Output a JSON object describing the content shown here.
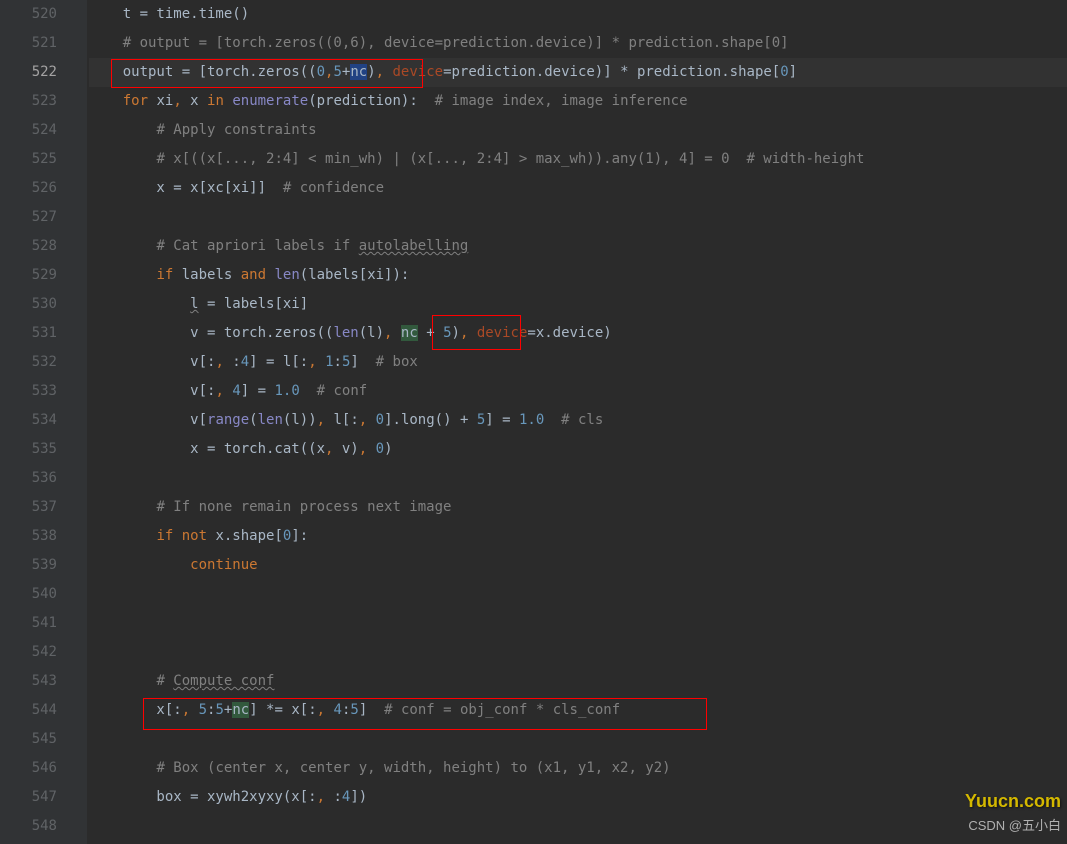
{
  "gutter": {
    "start": 520,
    "end": 548,
    "current": 522
  },
  "code": {
    "l520": {
      "pre": "    t = time.time()"
    },
    "l521": {
      "pre": "    ",
      "cmt": "# output = [torch.zeros((0,6), device=prediction.device)] * prediction.shape[0]"
    },
    "l522": {
      "a": "    output = [torch.zeros((",
      "n0": "0",
      "c": ",",
      "n5": "5",
      "plus": "+",
      "nc": "nc",
      "b": ")",
      "com": ",",
      "sp": " ",
      "dev": "device",
      "eq": "=prediction.device)] * prediction.shape[",
      "z": "0",
      "end": "]"
    },
    "l523": {
      "a": "    ",
      "for": "for",
      "b": " xi",
      "com": ",",
      "c": " x ",
      "in": "in",
      "d": " ",
      "enum": "enumerate",
      "e": "(prediction):  ",
      "cmt": "# image index, image inference"
    },
    "l524": {
      "pre": "        ",
      "cmt": "# Apply constraints"
    },
    "l525": {
      "pre": "        ",
      "cmt": "# x[((x[..., 2:4] < min_wh) | (x[..., 2:4] > max_wh)).any(1), 4] = 0  # width-height"
    },
    "l526": {
      "a": "        x = x[xc[xi]]  ",
      "cmt": "# confidence"
    },
    "l528": {
      "pre": "        ",
      "cmt1": "# Cat apriori labels if ",
      "auto": "autolabelling"
    },
    "l529": {
      "a": "        ",
      "if": "if",
      "b": " labels ",
      "and": "and",
      "c": " ",
      "len": "len",
      "d": "(labels[xi]):"
    },
    "l530": {
      "a": "            ",
      "l": "l",
      "b": " = labels[xi]"
    },
    "l531": {
      "a": "            v = torch.zeros((",
      "len": "len",
      "b": "(l)",
      "com": ",",
      "sp": " ",
      "nc": "nc",
      "c": " + ",
      "n5": "5",
      "d": ")",
      "com2": ",",
      "sp2": " ",
      "dev": "device",
      "e": "=x.device)"
    },
    "l532": {
      "a": "            v[:",
      "com": ",",
      "b": " :",
      "n4": "4",
      "c": "] = l[:",
      "com2": ",",
      "d": " ",
      "n1": "1",
      "e": ":",
      "n5": "5",
      "f": "]  ",
      "cmt": "# box"
    },
    "l533": {
      "a": "            v[:",
      "com": ",",
      "b": " ",
      "n4": "4",
      "c": "] = ",
      "f1": "1.0",
      "d": "  ",
      "cmt": "# conf"
    },
    "l534": {
      "a": "            v[",
      "range": "range",
      "b": "(",
      "len": "len",
      "c": "(l))",
      "com": ",",
      "d": " l[:",
      "com2": ",",
      "e": " ",
      "n0": "0",
      "f": "].long() + ",
      "n5": "5",
      "g": "] = ",
      "f1": "1.0",
      "h": "  ",
      "cmt": "# cls"
    },
    "l535": {
      "a": "            x = torch.cat((x",
      "com": ",",
      "b": " v)",
      "com2": ",",
      "c": " ",
      "n0": "0",
      "d": ")"
    },
    "l537": {
      "pre": "        ",
      "cmt": "# If none remain process next image"
    },
    "l538": {
      "a": "        ",
      "if": "if not",
      "b": " x.shape[",
      "n0": "0",
      "c": "]:"
    },
    "l539": {
      "a": "            ",
      "cont": "continue"
    },
    "l543": {
      "pre": "        ",
      "cmt1": "# ",
      "cc": "Compute conf"
    },
    "l544": {
      "a": "        x[:",
      "com": ",",
      "b": " ",
      "n5": "5",
      "c": ":",
      "n5b": "5",
      "plus": "+",
      "nc": "nc",
      "d": "] *= x[:",
      "com2": ",",
      "e": " ",
      "n4": "4",
      "f": ":",
      "n5c": "5",
      "g": "]  ",
      "cmt": "# conf = obj_conf * cls_conf"
    },
    "l546": {
      "pre": "        ",
      "cmt": "# Box (center x, center y, width, height) to (x1, y1, x2, y2)"
    },
    "l547": {
      "a": "        box = xywh2xyxy(x[:",
      "com": ",",
      "b": " :",
      "n4": "4",
      "c": "])"
    }
  },
  "watermark": "Yuucn.com",
  "csdn": "CSDN @五小白"
}
